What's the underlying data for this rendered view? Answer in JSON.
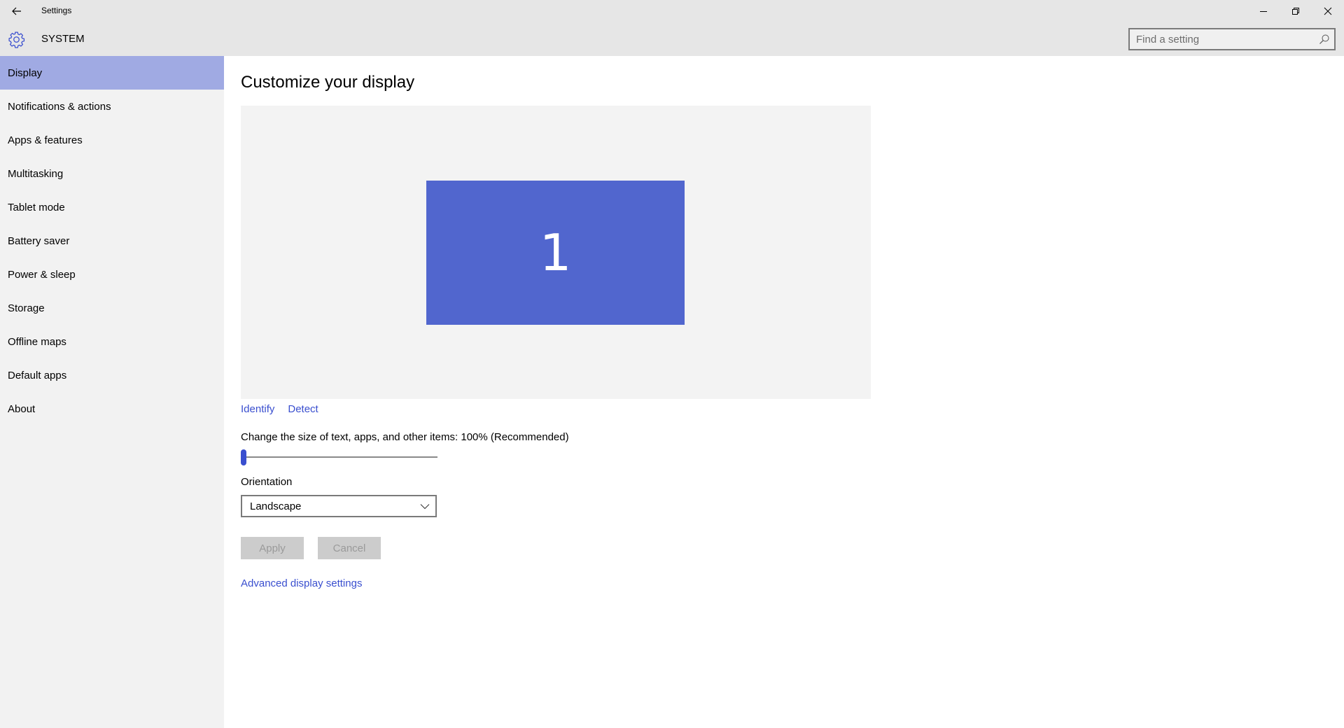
{
  "window": {
    "app_title": "Settings",
    "back_icon": "arrow-left-icon",
    "controls": {
      "minimize_icon": "minimize-icon",
      "maximize_icon": "restore-icon",
      "close_icon": "close-icon"
    }
  },
  "header": {
    "section_icon": "gear-icon",
    "section_title": "SYSTEM",
    "search": {
      "placeholder": "Find a setting",
      "value": "",
      "icon": "search-icon"
    }
  },
  "sidebar": {
    "items": [
      {
        "label": "Display",
        "active": true
      },
      {
        "label": "Notifications & actions",
        "active": false
      },
      {
        "label": "Apps & features",
        "active": false
      },
      {
        "label": "Multitasking",
        "active": false
      },
      {
        "label": "Tablet mode",
        "active": false
      },
      {
        "label": "Battery saver",
        "active": false
      },
      {
        "label": "Power & sleep",
        "active": false
      },
      {
        "label": "Storage",
        "active": false
      },
      {
        "label": "Offline maps",
        "active": false
      },
      {
        "label": "Default apps",
        "active": false
      },
      {
        "label": "About",
        "active": false
      }
    ]
  },
  "main": {
    "title": "Customize your display",
    "monitor_number": "1",
    "identify_label": "Identify",
    "detect_label": "Detect",
    "scale_label": "Change the size of text, apps, and other items: 100% (Recommended)",
    "scale_slider_fraction": 0,
    "orientation_label": "Orientation",
    "orientation_value": "Landscape",
    "apply_label": "Apply",
    "cancel_label": "Cancel",
    "advanced_link": "Advanced display settings"
  },
  "colors": {
    "accent": "#3a4fcf",
    "monitor_fill": "#5166ce",
    "nav_active": "#a0aae3",
    "header_bg": "#e6e6e6",
    "sidebar_bg": "#f2f2f2"
  }
}
